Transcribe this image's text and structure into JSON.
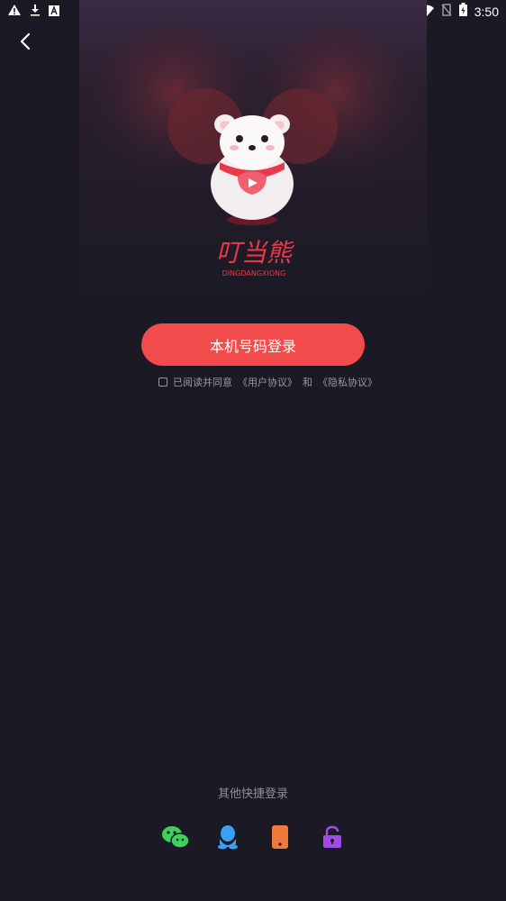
{
  "status_bar": {
    "time": "3:50",
    "icons": [
      "warning-icon",
      "download-icon",
      "a-icon",
      "wifi-icon",
      "no-sim-icon",
      "battery-charging-icon"
    ]
  },
  "nav": {
    "back_icon": "chevron-left-icon"
  },
  "brand": {
    "name_cn": "叮当熊",
    "name_en": "DINGDANGXIONG",
    "accent_color": "#f24b4b"
  },
  "login": {
    "button_label": "本机号码登录",
    "agreement_prefix": "已阅读并同意",
    "user_agreement": "《用户协议》",
    "conjunction": "和",
    "privacy_agreement": "《隐私协议》"
  },
  "quick_login": {
    "title": "其他快捷登录",
    "methods": [
      {
        "icon": "wechat-icon",
        "color": "#3fcf5b"
      },
      {
        "icon": "qq-icon",
        "color": "#3aa0f5"
      },
      {
        "icon": "phone-icon",
        "color": "#f07a3c"
      },
      {
        "icon": "lock-icon",
        "color": "#a04be8"
      }
    ]
  }
}
